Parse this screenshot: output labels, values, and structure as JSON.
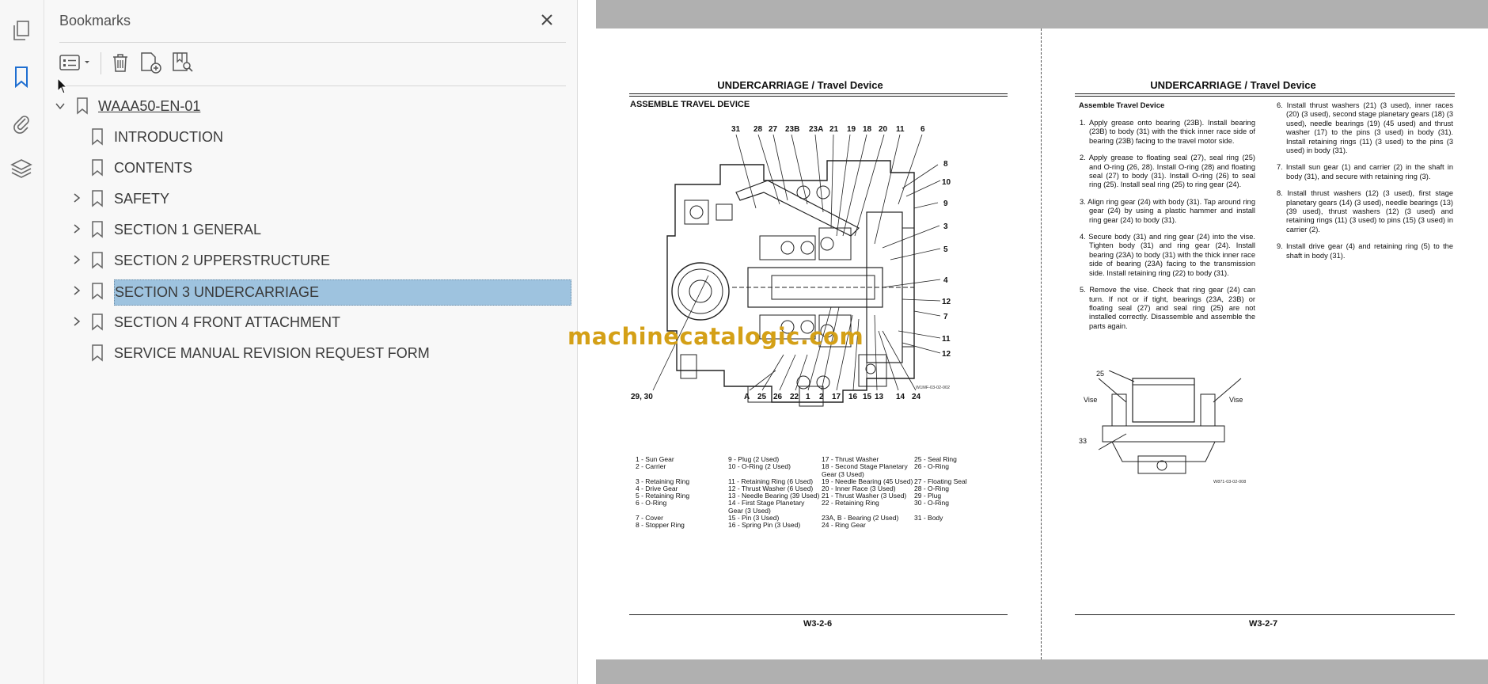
{
  "sidebar": {
    "panel_title": "Bookmarks",
    "rail_icons": [
      "pages-icon",
      "bookmark-icon",
      "attachment-icon",
      "layers-icon"
    ],
    "toolbar_icons": [
      "options-list-icon",
      "delete-icon",
      "new-bookmark-icon",
      "find-bookmark-icon"
    ],
    "items": [
      {
        "label": "WAAA50-EN-01",
        "expanded": true
      },
      {
        "label": "INTRODUCTION"
      },
      {
        "label": "CONTENTS"
      },
      {
        "label": "SAFETY",
        "has_children": true
      },
      {
        "label": "SECTION 1 GENERAL",
        "has_children": true
      },
      {
        "label": "SECTION 2 UPPERSTRUCTURE",
        "has_children": true
      },
      {
        "label": "SECTION 3 UNDERCARRIAGE",
        "has_children": true,
        "selected": true
      },
      {
        "label": "SECTION 4 FRONT ATTACHMENT",
        "has_children": true
      },
      {
        "label": "SERVICE MANUAL REVISION REQUEST FORM"
      }
    ],
    "selected_color": "#9ec3df"
  },
  "watermark": "machinecatalogic.com",
  "left_page": {
    "header": "UNDERCARRIAGE / Travel Device",
    "subtitle": "ASSEMBLE TRAVEL DEVICE",
    "figure_id": "W1MF-03-02-002",
    "callouts_top": [
      "31",
      "28",
      "27",
      "23B",
      "23A",
      "21",
      "19",
      "18",
      "20",
      "11",
      "6"
    ],
    "callouts_right": [
      "8",
      "10",
      "9",
      "3",
      "5",
      "4",
      "12",
      "7",
      "11",
      "12"
    ],
    "callouts_bottom": [
      "29, 30",
      "A",
      "25",
      "26",
      "22",
      "1",
      "2",
      "17",
      "16",
      "15",
      "13",
      "14",
      "24"
    ],
    "legend": [
      [
        "1 -",
        "Sun Gear"
      ],
      [
        "2 -",
        "Carrier"
      ],
      [
        "3 -",
        "Retaining Ring"
      ],
      [
        "4 -",
        "Drive Gear"
      ],
      [
        "5 -",
        "Retaining Ring"
      ],
      [
        "6 -",
        "O-Ring"
      ],
      [
        "7 -",
        "Cover"
      ],
      [
        "8 -",
        "Stopper Ring"
      ],
      [
        "9 -",
        "Plug (2 Used)"
      ],
      [
        "10 -",
        "O-Ring (2 Used)"
      ],
      [
        "11 -",
        "Retaining Ring (6 Used)"
      ],
      [
        "12 -",
        "Thrust Washer (6 Used)"
      ],
      [
        "13 -",
        "Needle Bearing (39 Used)"
      ],
      [
        "14 -",
        "First Stage Planetary Gear (3 Used)"
      ],
      [
        "15 -",
        "Pin (3 Used)"
      ],
      [
        "16 -",
        "Spring Pin (3 Used)"
      ],
      [
        "17 -",
        "Thrust Washer"
      ],
      [
        "18 -",
        "Second Stage Planetary Gear (3 Used)"
      ],
      [
        "19 -",
        "Needle Bearing (45 Used)"
      ],
      [
        "20 -",
        "Inner Race (3 Used)"
      ],
      [
        "21 -",
        "Thrust Washer (3 Used)"
      ],
      [
        "22 -",
        "Retaining Ring"
      ],
      [
        "23A, B -",
        "Bearing (2 Used)"
      ],
      [
        "24 -",
        "Ring Gear"
      ],
      [
        "25 -",
        "Seal Ring"
      ],
      [
        "26 -",
        "O-Ring"
      ],
      [
        "27 -",
        "Floating Seal"
      ],
      [
        "28 -",
        "O-Ring"
      ],
      [
        "29 -",
        "Plug"
      ],
      [
        "30 -",
        "O-Ring"
      ],
      [
        "31 -",
        "Body"
      ]
    ],
    "page_number": "W3-2-6"
  },
  "right_page": {
    "header": "UNDERCARRIAGE / Travel Device",
    "subtitle": "Assemble Travel Device",
    "steps_col1": [
      "1. Apply grease onto bearing (23B). Install bearing (23B) to body (31) with the thick inner race side of bearing (23B) facing to the travel motor side.",
      "2. Apply grease to floating seal (27), seal ring (25) and O-ring (26, 28). Install O-ring (28) and floating seal (27) to body (31). Install O-ring (26) to seal ring (25). Install seal ring (25) to ring gear (24).",
      "3. Align ring gear (24) with body (31). Tap around ring gear (24) by using a plastic hammer and install ring gear (24) to body (31).",
      "4. Secure body (31) and ring gear (24) into the vise. Tighten body (31) and ring gear (24). Install bearing (23A) to body (31) with the thick inner race side of bearing (23A) facing to the transmission side. Install retaining ring (22) to body (31).",
      "5. Remove the vise. Check that ring gear (24) can turn. If not or if tight, bearings (23A, 23B) or floating seal (27) and seal ring (25) are not installed correctly. Disassemble and assemble the parts again."
    ],
    "steps_col2": [
      "6. Install thrust washers (21) (3 used), inner races (20) (3 used), second stage planetary gears (18) (3 used), needle bearings (19) (45 used) and thrust washer (17) to the pins (3 used) in body (31). Install retaining rings (11) (3 used) to the pins (3 used) in body (31).",
      "7. Install sun gear (1) and carrier (2) in the shaft in body (31), and secure with retaining ring (3).",
      "8. Install thrust washers (12) (3 used), first stage planetary gears (14) (3 used), needle bearings (13) (39 used), thrust washers (12) (3 used) and retaining rings (11) (3 used) to pins (15) (3 used) in carrier (2).",
      "9. Install drive gear (4) and retaining ring (5) to the shaft in body (31)."
    ],
    "figure_labels": {
      "top": "25",
      "left": "Vise",
      "right": "Vise",
      "bottom": "33",
      "id": "W871-03-02-008"
    },
    "page_number": "W3-2-7"
  }
}
